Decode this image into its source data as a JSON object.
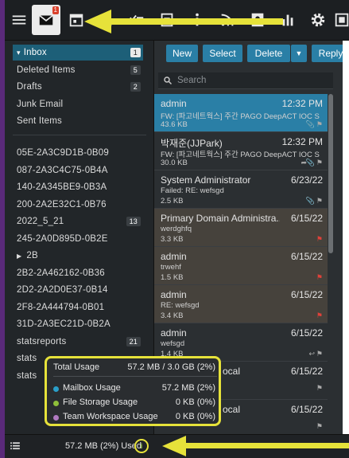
{
  "toolbar": {
    "items": [
      "menu-icon",
      "mail-icon",
      "calendar-icon",
      "person-icon",
      "tasks-icon",
      "notes-icon",
      "info-icon",
      "rss-icon",
      "contacts-icon",
      "chart-icon",
      "gear-icon",
      "apps-icon"
    ],
    "mail_badge": "1"
  },
  "sidebar": {
    "folders": [
      {
        "label": "Inbox",
        "count": "1",
        "selected": true,
        "expand": true
      },
      {
        "label": "Deleted Items",
        "count": "5"
      },
      {
        "label": "Drafts",
        "count": "2"
      },
      {
        "label": "Junk Email",
        "count": ""
      },
      {
        "label": "Sent Items",
        "count": ""
      }
    ],
    "subfolders": [
      {
        "label": "05E-2A3C9D1B-0B09",
        "count": ""
      },
      {
        "label": "087-2A3C4C75-0B4A",
        "count": ""
      },
      {
        "label": "140-2A345BE9-0B3A",
        "count": ""
      },
      {
        "label": "200-2A2E32C1-0B76",
        "count": ""
      },
      {
        "label": "2022_5_21",
        "count": "13"
      },
      {
        "label": "245-2A0D895D-0B2E",
        "count": ""
      },
      {
        "label": "2B",
        "count": "",
        "expand": true
      },
      {
        "label": "2B2-2A462162-0B36",
        "count": ""
      },
      {
        "label": "2D2-2A2D0E37-0B14",
        "count": ""
      },
      {
        "label": "2F8-2A444794-0B01",
        "count": ""
      },
      {
        "label": "31D-2A3EC21D-0B2A",
        "count": ""
      },
      {
        "label": "statsreports",
        "count": "21"
      },
      {
        "label": "stats",
        "count": ""
      },
      {
        "label": "stats",
        "count": ""
      }
    ]
  },
  "main": {
    "buttons": {
      "new": "New",
      "select": "Select",
      "delete": "Delete",
      "reply": "Reply"
    },
    "search_placeholder": "Search",
    "messages": [
      {
        "sender": "admin",
        "time": "12:32 PM",
        "subject": "FW: [파고네트웍스] 주간 PAGO DeepACT IOC S...",
        "size": "43.6 KB",
        "selected": true,
        "flag": false
      },
      {
        "sender": "박재준(JJPark)",
        "time": "12:32 PM",
        "subject": "FW: [파고네트웍스] 주간 PAGO DeepACT IOC Sh...",
        "size": "30.0 KB",
        "selected": false,
        "flag": false
      },
      {
        "sender": "System Administrator",
        "time": "6/23/22",
        "subject": "Failed: RE: wefsgd",
        "size": "2.5 KB",
        "selected": false,
        "flag": false
      },
      {
        "sender": "Primary Domain Administra...",
        "time": "6/15/22",
        "subject": "werdghfq",
        "size": "3.3 KB",
        "selected": false,
        "flag": true
      },
      {
        "sender": "admin",
        "time": "6/15/22",
        "subject": "trwehf",
        "size": "1.5 KB",
        "selected": false,
        "flag": true
      },
      {
        "sender": "admin",
        "time": "6/15/22",
        "subject": "RE: wefsgd",
        "size": "3.4 KB",
        "selected": false,
        "flag": true
      },
      {
        "sender": "admin",
        "time": "6/15/22",
        "subject": "wefsgd",
        "size": "1.4 KB",
        "selected": false,
        "flag": false
      },
      {
        "sender": "ocal",
        "time": "6/15/22",
        "subject": "",
        "size": "",
        "selected": false,
        "flag": false
      },
      {
        "sender": "ocal",
        "time": "6/15/22",
        "subject": "",
        "size": "",
        "selected": false,
        "flag": false
      }
    ]
  },
  "usage": {
    "total_label": "Total Usage",
    "total_value": "57.2 MB / 3.0 GB (2%)",
    "rows": [
      {
        "label": "Mailbox Usage",
        "value": "57.2 MB (2%)",
        "color": "#2a9fc9"
      },
      {
        "label": "File Storage Usage",
        "value": "0 KB (0%)",
        "color": "#8fbf3a"
      },
      {
        "label": "Team Workspace Usage",
        "value": "0 KB (0%)",
        "color": "#b07ac0"
      }
    ]
  },
  "statusbar": {
    "used_text": "57.2 MB (2%) Used"
  },
  "colors": {
    "accent": "#2a7fa6",
    "highlight": "#e6e23a",
    "flag": "#e0413a"
  }
}
